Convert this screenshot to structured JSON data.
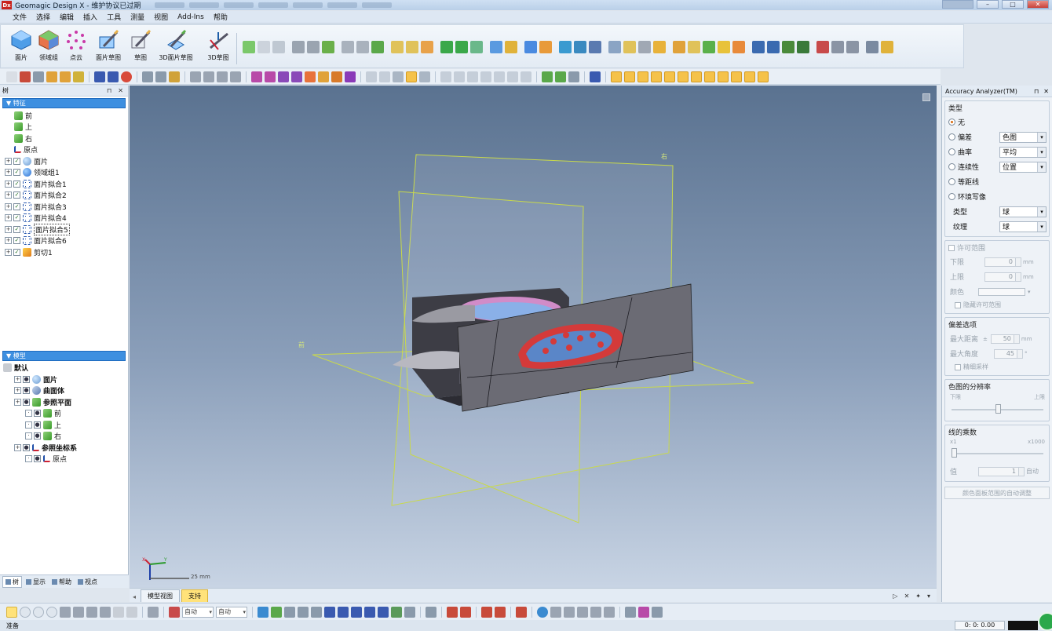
{
  "window": {
    "logo": "Dx",
    "title": "Geomagic Design X - 维护协议已过期",
    "controls": {
      "minimize": "–",
      "maximize": "□",
      "close": "✕"
    }
  },
  "menubar": [
    "文件",
    "选择",
    "编辑",
    "插入",
    "工具",
    "测量",
    "视图",
    "Add-Ins",
    "帮助"
  ],
  "ribbon": {
    "big_tools": [
      "面片",
      "领域组",
      "点云",
      "面片草图",
      "草图",
      "3D面片草图",
      "3D草图"
    ]
  },
  "tree_panel": {
    "title": "树",
    "pin": "⊓",
    "close": "✕",
    "features_header": "特征",
    "features": [
      {
        "label": "前",
        "icon": "plane-icon"
      },
      {
        "label": "上",
        "icon": "plane-icon"
      },
      {
        "label": "右",
        "icon": "plane-icon"
      },
      {
        "label": "原点",
        "icon": "axis-icon"
      },
      {
        "label": "面片",
        "icon": "mesh-icon",
        "expand": true
      },
      {
        "label": "领域组1",
        "icon": "region-group-icon",
        "expand": true
      },
      {
        "label": "面片拟合1",
        "icon": "mesh-fit-icon",
        "expand": true
      },
      {
        "label": "面片拟合2",
        "icon": "mesh-fit-icon",
        "expand": true
      },
      {
        "label": "面片拟合3",
        "icon": "mesh-fit-icon",
        "expand": true
      },
      {
        "label": "面片拟合4",
        "icon": "mesh-fit-icon",
        "expand": true
      },
      {
        "label": "面片拟合5",
        "icon": "mesh-fit-icon",
        "expand": true,
        "boxed": true
      },
      {
        "label": "面片拟合6",
        "icon": "mesh-fit-icon",
        "expand": true
      },
      {
        "label": "剪切1",
        "icon": "cut-icon",
        "expand": true
      }
    ],
    "model_header": "模型",
    "model": [
      {
        "label": "默认",
        "level": 0,
        "bold": true
      },
      {
        "label": "面片",
        "level": 1,
        "bold": true,
        "icon": "mesh-icon"
      },
      {
        "label": "曲面体",
        "level": 1,
        "bold": true,
        "icon": "surface-body-icon"
      },
      {
        "label": "参照平面",
        "level": 1,
        "bold": true,
        "icon": "plane-icon"
      },
      {
        "label": "前",
        "level": 2,
        "icon": "plane-icon"
      },
      {
        "label": "上",
        "level": 2,
        "icon": "plane-icon"
      },
      {
        "label": "右",
        "level": 2,
        "icon": "plane-icon"
      },
      {
        "label": "参照坐标系",
        "level": 1,
        "bold": true,
        "icon": "axis-icon"
      },
      {
        "label": "原点",
        "level": 2,
        "icon": "axis-icon"
      }
    ],
    "tabs": [
      "树",
      "显示",
      "帮助",
      "视点"
    ]
  },
  "viewport": {
    "plane_labels": {
      "right": "右",
      "front": "前"
    },
    "scale_label": "25 mm",
    "tabs": [
      "模型视图",
      "支持"
    ],
    "active_tab": "支持",
    "nav": {
      "prev": "▷",
      "close": "✕",
      "pin": "✦",
      "menu": "▾"
    },
    "triad": {
      "x": "X",
      "y": "Y"
    }
  },
  "accuracy_analyzer": {
    "title": "Accuracy Analyzer(TM)",
    "pin": "⊓",
    "close": "✕",
    "type_group": {
      "title": "类型",
      "options": [
        {
          "label": "无",
          "selected": true
        },
        {
          "label": "偏差",
          "selected": false,
          "value": "色图"
        },
        {
          "label": "曲率",
          "selected": false,
          "value": "平均"
        },
        {
          "label": "连续性",
          "selected": false,
          "value": "位置"
        },
        {
          "label": "等距线",
          "selected": false
        },
        {
          "label": "环境写像",
          "selected": false
        }
      ],
      "fields": [
        {
          "label": "类型",
          "value": "球"
        },
        {
          "label": "纹理",
          "value": "球"
        }
      ]
    },
    "tolerance_group": {
      "title": "许可范围",
      "lower_label": "下限",
      "lower_value": "0",
      "lower_unit": "mm",
      "upper_label": "上限",
      "upper_value": "0",
      "upper_unit": "mm",
      "color_label": "颜色",
      "hide_label": "隐藏许可范围"
    },
    "deviation_group": {
      "title": "偏差选项",
      "max_dist_label": "最大距离",
      "max_dist_prefix": "±",
      "max_dist_value": "50",
      "max_dist_unit": "mm",
      "max_angle_label": "最大角度",
      "max_angle_value": "45",
      "max_angle_unit": "°",
      "precise_label": "精细采样"
    },
    "resolution_group": {
      "title": "色图的分辨率",
      "low": "下限",
      "high": "上限",
      "level": 0.5
    },
    "lines_group": {
      "title": "线的乘数",
      "min": "x1",
      "max": "x1000",
      "value_label": "值",
      "value": "1",
      "auto_label": "自动",
      "level": 0
    },
    "auto_adjust_button": "颜色面板范围的自动调整"
  },
  "bottom_toolbar": {
    "dropdowns": [
      "自动",
      "自动"
    ]
  },
  "status": {
    "text": "准备",
    "time": "0: 0: 0.00"
  },
  "colors": {
    "viewport_top": "#5a7290",
    "viewport_bottom": "#c8d4e4",
    "plane_edge": "#c9d94a",
    "selection": "#3d8fe0"
  }
}
